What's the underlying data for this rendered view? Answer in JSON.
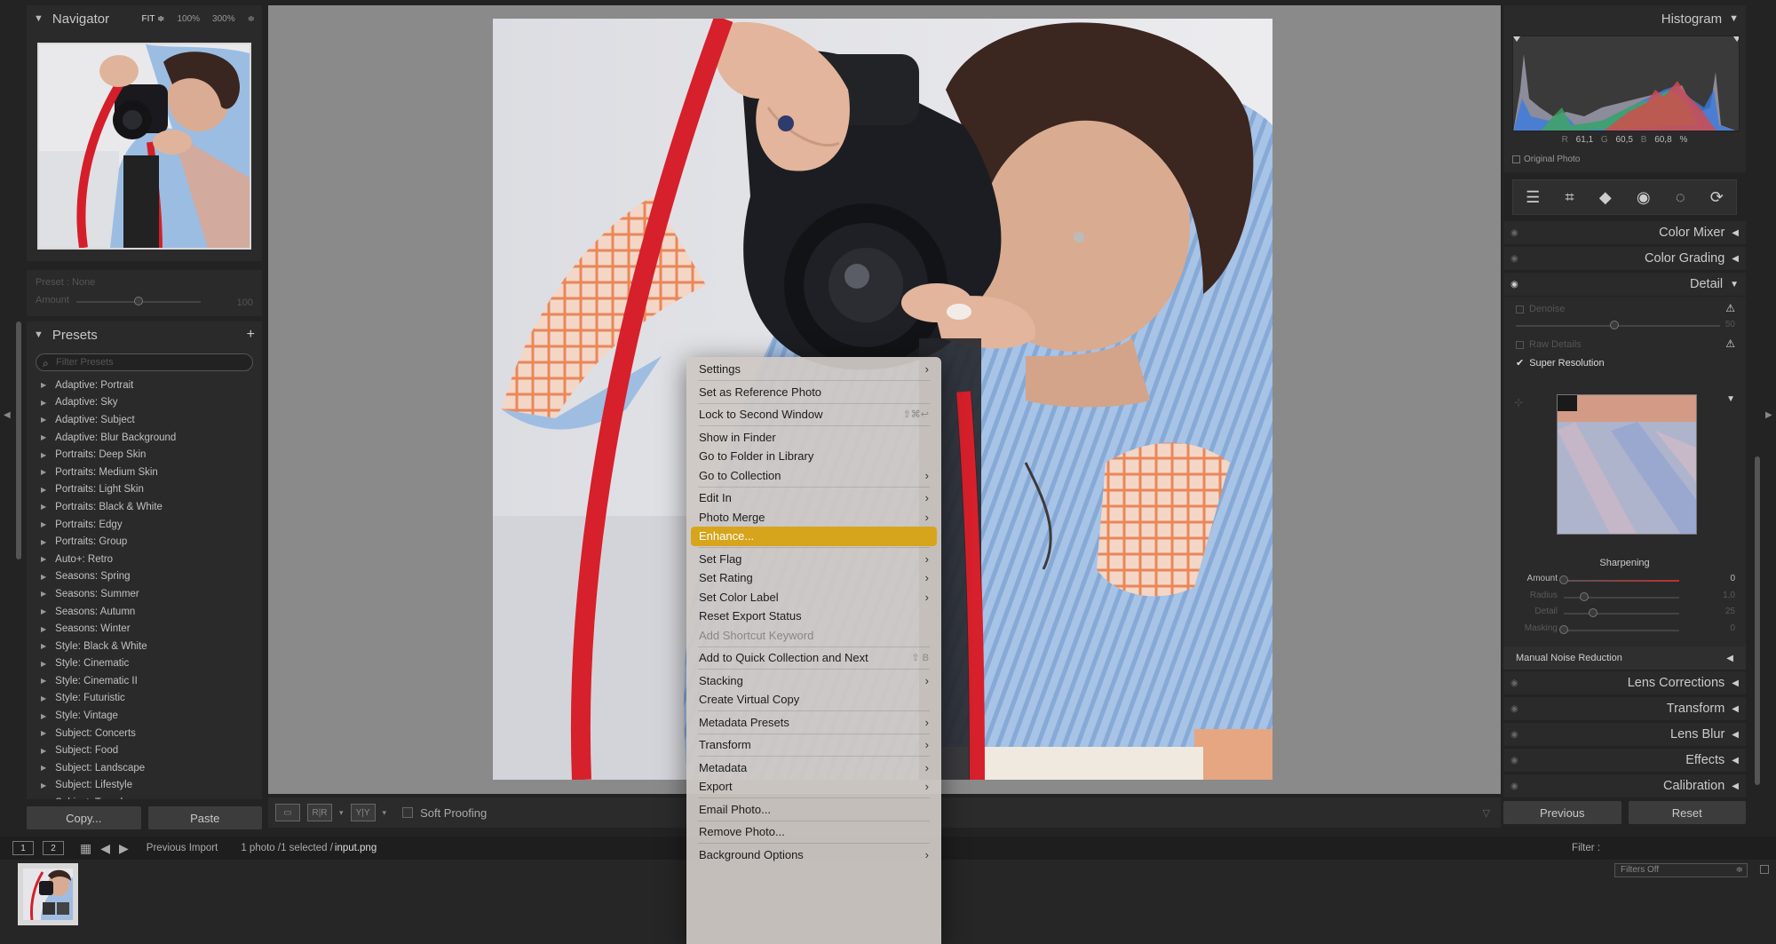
{
  "navigator": {
    "title": "Navigator",
    "zoom": [
      "FIT ≑",
      "100%",
      "300%",
      "≑"
    ]
  },
  "preset_amount": {
    "preset": "Preset : None",
    "amount_label": "Amount",
    "amount_value": "100",
    "amount_fraction": 0.5
  },
  "presets": {
    "title": "Presets",
    "add": "+",
    "search_placeholder": "Filter Presets",
    "items": [
      "Adaptive: Portrait",
      "Adaptive: Sky",
      "Adaptive: Subject",
      "Adaptive: Blur Background",
      "Portraits: Deep Skin",
      "Portraits: Medium Skin",
      "Portraits: Light Skin",
      "Portraits: Black & White",
      "Portraits: Edgy",
      "Portraits: Group",
      "Auto+: Retro",
      "Seasons: Spring",
      "Seasons: Summer",
      "Seasons: Autumn",
      "Seasons: Winter",
      "Style: Black & White",
      "Style: Cinematic",
      "Style: Cinematic II",
      "Style: Futuristic",
      "Style: Vintage",
      "Subject: Concerts",
      "Subject: Food",
      "Subject: Landscape",
      "Subject: Lifestyle",
      "Subject: Travel"
    ]
  },
  "left_buttons": {
    "copy": "Copy...",
    "paste": "Paste"
  },
  "toolbar": {
    "view1": "▭",
    "view2": "R|R",
    "view3": "Y|Y",
    "soft_proofing": "Soft Proofing"
  },
  "histogram": {
    "title": "Histogram",
    "r_label": "R",
    "r": "61,1",
    "g_label": "G",
    "g": "60,5",
    "b_label": "B",
    "b": "60,8",
    "unit": "%",
    "original_photo": "Original Photo"
  },
  "sections": {
    "color_mixer": "Color Mixer",
    "color_grading": "Color Grading",
    "detail": "Detail",
    "lens_corrections": "Lens Corrections",
    "transform": "Transform",
    "lens_blur": "Lens Blur",
    "effects": "Effects",
    "calibration": "Calibration"
  },
  "detail": {
    "denoise": "Denoise",
    "denoise_value": "50",
    "raw_details": "Raw Details",
    "super_resolution": "Super Resolution",
    "sharpening": "Sharpening",
    "sliders": [
      {
        "name": "Amount",
        "value": "0"
      },
      {
        "name": "Radius",
        "value": "1,0"
      },
      {
        "name": "Detail",
        "value": "25"
      },
      {
        "name": "Masking",
        "value": "0"
      }
    ],
    "manual_noise": "Manual Noise Reduction"
  },
  "right_buttons": {
    "previous": "Previous",
    "reset": "Reset"
  },
  "filmstrip": {
    "page1": "1",
    "page2": "2",
    "source": "Previous Import",
    "count": "1 photo /1 selected /",
    "filename": "input.png",
    "filter_label": "Filter :",
    "filter_value": "Filters Off"
  },
  "context_menu": {
    "settings": "Settings",
    "set_reference": "Set as Reference Photo",
    "lock_second": "Lock to Second Window",
    "lock_shortcut": "⇧⌘↩",
    "show_finder": "Show in Finder",
    "goto_folder": "Go to Folder in Library",
    "goto_collection": "Go to Collection",
    "edit_in": "Edit In",
    "photo_merge": "Photo Merge",
    "enhance": "Enhance...",
    "set_flag": "Set Flag",
    "set_rating": "Set Rating",
    "set_color_label": "Set Color Label",
    "reset_export": "Reset Export Status",
    "add_shortcut_kw": "Add Shortcut Keyword",
    "add_quick": "Add to Quick Collection and Next",
    "add_quick_shortcut": "⇧ B",
    "stacking": "Stacking",
    "virtual_copy": "Create Virtual Copy",
    "metadata_presets": "Metadata Presets",
    "transform": "Transform",
    "metadata": "Metadata",
    "export": "Export",
    "email": "Email Photo...",
    "remove": "Remove Photo...",
    "background": "Background Options"
  },
  "colors": {
    "highlight": "#d6a51c",
    "strap_red": "#d6202b",
    "shirt_blue": "#8fb3dc"
  }
}
